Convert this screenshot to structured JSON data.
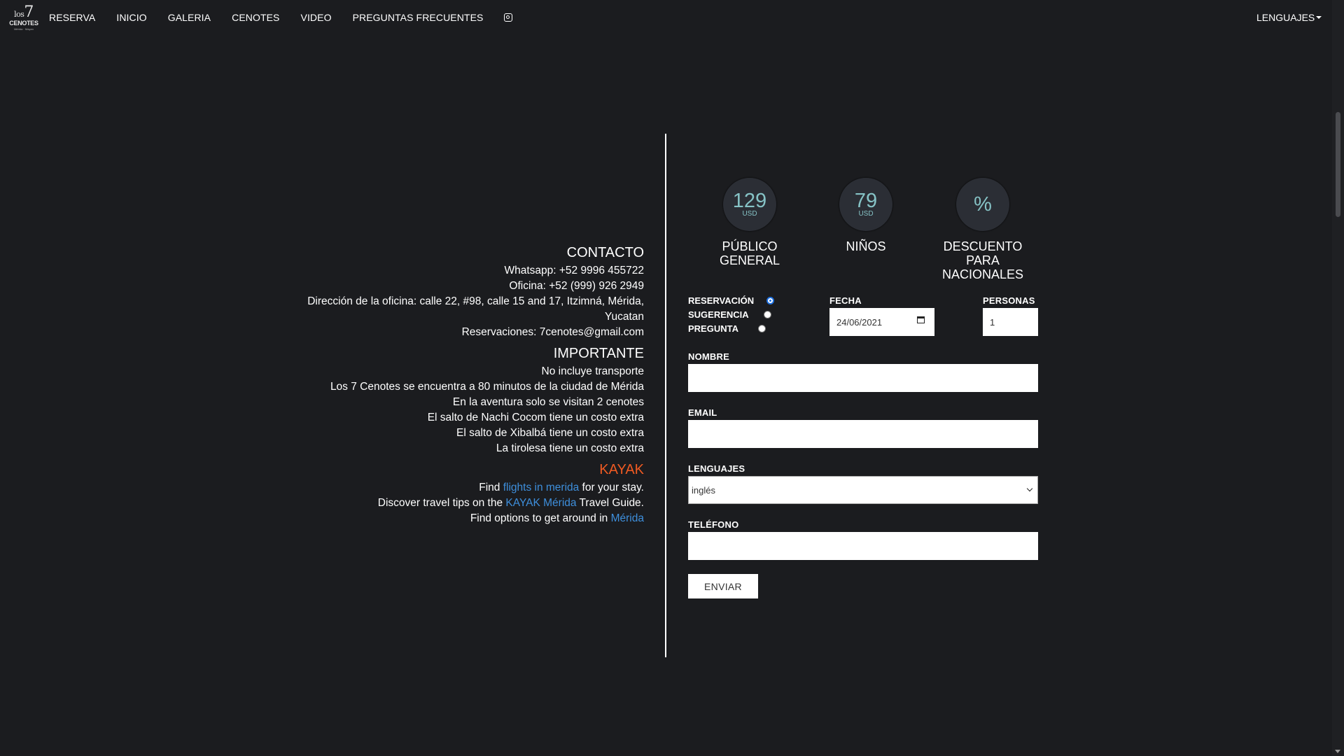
{
  "logo": {
    "line1_small": "los",
    "line1_big": "7",
    "line2": "CENOTES",
    "line3": "Mérida · Mayan"
  },
  "nav": {
    "items": [
      "RESERVA",
      "INICIO",
      "GALERIA",
      "CENOTES",
      "VIDEO",
      "PREGUNTAS FRECUENTES"
    ],
    "instagram_icon": "instagram-icon",
    "languages_label": "LENGUAJES"
  },
  "contact": {
    "title": "CONTACTO",
    "lines": [
      "Whatsapp: +52 9996 455722",
      "Oficina: +52 (999) 926 2949",
      "Dirección de la oficina: calle 22, #98, calle 15 and 17, Itzimná, Mérida,",
      "Yucatan",
      "Reservaciones: 7cenotes@gmail.com"
    ]
  },
  "important": {
    "title": "IMPORTANTE",
    "lines": [
      "No incluye transporte",
      "Los 7 Cenotes se encuentra a 80 minutos de la ciudad de Mérida",
      "En la aventura solo se visitan 2 cenotes",
      "El salto de Nachi Cocom tiene un costo extra",
      "El salto de Xibalbá tiene un costo extra",
      "La tirolesa tiene un costo extra"
    ]
  },
  "kayak": {
    "title": "KAYAK",
    "line1": {
      "pre": "Find ",
      "link": "flights in merida",
      "post": " for your stay."
    },
    "line2": {
      "pre": "Discover travel tips on the ",
      "link": "KAYAK Mérida",
      "post": " Travel Guide."
    },
    "line3": {
      "pre": "Find options to get around in ",
      "link": "Mérida"
    }
  },
  "prices": [
    {
      "value": "129",
      "unit": "USD",
      "label_lines": [
        "PÚBLICO",
        "GENERAL"
      ]
    },
    {
      "value": "79",
      "unit": "USD",
      "label_lines": [
        "NIÑOS"
      ]
    },
    {
      "value": "%",
      "unit": "",
      "label_lines": [
        "DESCUENTO",
        "PARA",
        "NACIONALES"
      ]
    }
  ],
  "form": {
    "types": [
      {
        "label": "RESERVACIÓN",
        "checked": true
      },
      {
        "label": "SUGERENCIA",
        "checked": false
      },
      {
        "label": "PREGUNTA",
        "checked": false
      }
    ],
    "date_label": "FECHA",
    "date_value": "24/06/2021",
    "people_label": "PERSONAS",
    "people_value": "1",
    "name_label": "NOMBRE",
    "name_value": "",
    "email_label": "EMAIL",
    "email_value": "",
    "language_label": "LENGUAJES",
    "language_value": "inglés",
    "phone_label": "TELÉFONO",
    "phone_value": "",
    "send_label": "ENVIAR"
  },
  "colors": {
    "background": "#1b1c1f",
    "accent_teal": "#86c3c6",
    "kayak_orange": "#f05a22",
    "link_blue": "#3e8fdc"
  }
}
